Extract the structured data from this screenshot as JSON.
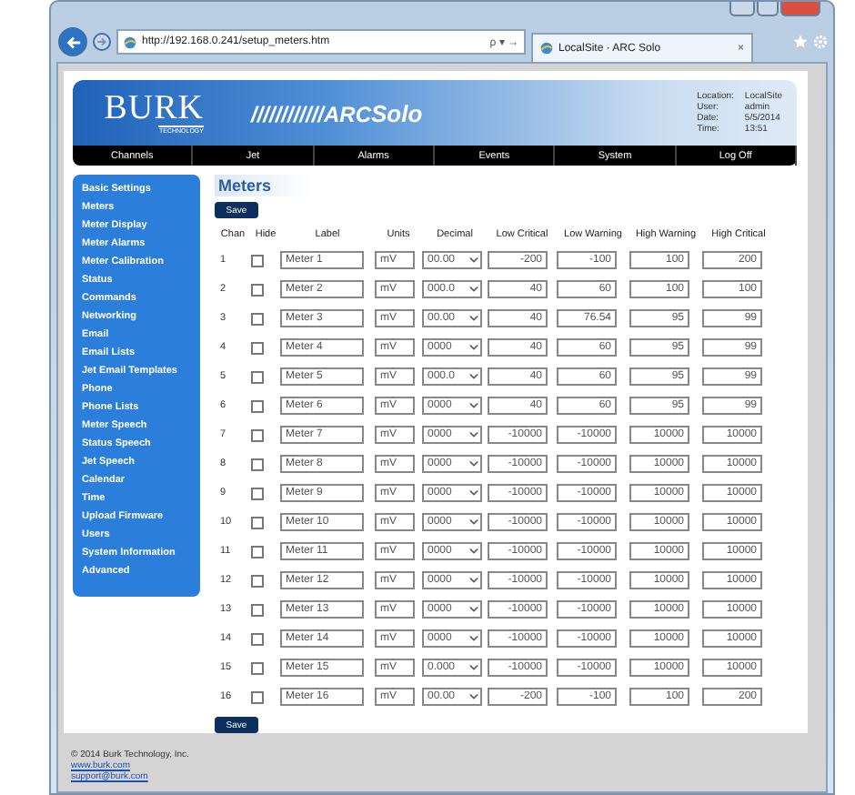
{
  "browser": {
    "address": "http://192.168.0.241/setup_meters.htm",
    "search_glyph": "ρ ▾ →",
    "tab": {
      "title": "LocalSite · ARC Solo",
      "close": "×"
    }
  },
  "header": {
    "logo": "BURK",
    "logo_sub": "TECHNOLOGY",
    "product_prefix": "////////////ARC",
    "product": "Solo",
    "info": [
      {
        "label": "Location:",
        "value": "LocalSite"
      },
      {
        "label": "User:",
        "value": "admin"
      },
      {
        "label": "Date:",
        "value": "5/5/2014"
      },
      {
        "label": "Time:",
        "value": "13:51"
      }
    ]
  },
  "nav": [
    "Channels",
    "Jet",
    "Alarms",
    "Events",
    "System",
    "Log Off"
  ],
  "sidebar": {
    "items": [
      "Basic Settings",
      "Meters",
      "Meter Display",
      "Meter Alarms",
      "Meter Calibration",
      "Status",
      "Commands",
      "Networking",
      "Email",
      "Email Lists",
      "Jet Email Templates",
      "Phone",
      "Phone Lists",
      "Meter Speech",
      "Status Speech",
      "Jet Speech",
      "Calendar",
      "Time",
      "Upload Firmware",
      "Users",
      "System Information",
      "Advanced"
    ]
  },
  "page_title": "Meters",
  "save_buttons": [
    "Save",
    "Save"
  ],
  "table": {
    "columns": [
      "Chan",
      "Hide",
      "Label",
      "Units",
      "Decimal",
      "Low Critical",
      "Low Warning",
      "High Warning",
      "High Critical"
    ],
    "rows": [
      {
        "chan": "1",
        "hide": false,
        "label": "Meter 1",
        "units": "mV",
        "decimal": "00.00",
        "low_critical": "-200",
        "low_warning": "-100",
        "high_warning": "100",
        "high_critical": "200"
      },
      {
        "chan": "2",
        "hide": false,
        "label": "Meter 2",
        "units": "mV",
        "decimal": "000.0",
        "low_critical": "40",
        "low_warning": "60",
        "high_warning": "100",
        "high_critical": "100"
      },
      {
        "chan": "3",
        "hide": false,
        "label": "Meter 3",
        "units": "mV",
        "decimal": "00.00",
        "low_critical": "40",
        "low_warning": "76.54",
        "high_warning": "95",
        "high_critical": "99"
      },
      {
        "chan": "4",
        "hide": false,
        "label": "Meter 4",
        "units": "mV",
        "decimal": "0000",
        "low_critical": "40",
        "low_warning": "60",
        "high_warning": "95",
        "high_critical": "99"
      },
      {
        "chan": "5",
        "hide": false,
        "label": "Meter 5",
        "units": "mV",
        "decimal": "000.0",
        "low_critical": "40",
        "low_warning": "60",
        "high_warning": "95",
        "high_critical": "99"
      },
      {
        "chan": "6",
        "hide": false,
        "label": "Meter 6",
        "units": "mV",
        "decimal": "0000",
        "low_critical": "40",
        "low_warning": "60",
        "high_warning": "95",
        "high_critical": "99"
      },
      {
        "chan": "7",
        "hide": false,
        "label": "Meter 7",
        "units": "mV",
        "decimal": "0000",
        "low_critical": "-10000",
        "low_warning": "-10000",
        "high_warning": "10000",
        "high_critical": "10000"
      },
      {
        "chan": "8",
        "hide": false,
        "label": "Meter 8",
        "units": "mV",
        "decimal": "0000",
        "low_critical": "-10000",
        "low_warning": "-10000",
        "high_warning": "10000",
        "high_critical": "10000"
      },
      {
        "chan": "9",
        "hide": false,
        "label": "Meter 9",
        "units": "mV",
        "decimal": "0000",
        "low_critical": "-10000",
        "low_warning": "-10000",
        "high_warning": "10000",
        "high_critical": "10000"
      },
      {
        "chan": "10",
        "hide": false,
        "label": "Meter 10",
        "units": "mV",
        "decimal": "0000",
        "low_critical": "-10000",
        "low_warning": "-10000",
        "high_warning": "10000",
        "high_critical": "10000"
      },
      {
        "chan": "11",
        "hide": false,
        "label": "Meter 11",
        "units": "mV",
        "decimal": "0000",
        "low_critical": "-10000",
        "low_warning": "-10000",
        "high_warning": "10000",
        "high_critical": "10000"
      },
      {
        "chan": "12",
        "hide": false,
        "label": "Meter 12",
        "units": "mV",
        "decimal": "0000",
        "low_critical": "-10000",
        "low_warning": "-10000",
        "high_warning": "10000",
        "high_critical": "10000"
      },
      {
        "chan": "13",
        "hide": false,
        "label": "Meter 13",
        "units": "mV",
        "decimal": "0000",
        "low_critical": "-10000",
        "low_warning": "-10000",
        "high_warning": "10000",
        "high_critical": "10000"
      },
      {
        "chan": "14",
        "hide": false,
        "label": "Meter 14",
        "units": "mV",
        "decimal": "0000",
        "low_critical": "-10000",
        "low_warning": "-10000",
        "high_warning": "10000",
        "high_critical": "10000"
      },
      {
        "chan": "15",
        "hide": false,
        "label": "Meter 15",
        "units": "mV",
        "decimal": "0.000",
        "low_critical": "-10000",
        "low_warning": "-10000",
        "high_warning": "10000",
        "high_critical": "10000"
      },
      {
        "chan": "16",
        "hide": false,
        "label": "Meter 16",
        "units": "mV",
        "decimal": "00.00",
        "low_critical": "-200",
        "low_warning": "-100",
        "high_warning": "100",
        "high_critical": "200"
      }
    ]
  },
  "footer": {
    "copyright": "© 2014 Burk Technology, Inc.",
    "links": [
      "www.burk.com",
      "support@burk.com"
    ]
  }
}
